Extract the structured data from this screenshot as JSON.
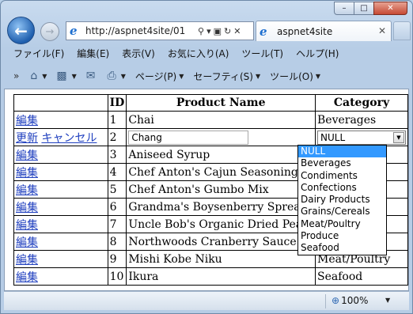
{
  "window": {
    "caption_buttons": {
      "minimize": "–",
      "maximize": "□",
      "close": "✕"
    }
  },
  "nav": {
    "address_url": "http://aspnet4site/01",
    "tab_title": "aspnet4site"
  },
  "menubar": [
    "ファイル(F)",
    "編集(E)",
    "表示(V)",
    "お気に入り(A)",
    "ツール(T)",
    "ヘルプ(H)"
  ],
  "commandbar": {
    "page": "ページ(P)",
    "safety": "セーフティ(S)",
    "tools": "ツール(O)"
  },
  "grid": {
    "headers": [
      "",
      "ID",
      "Product Name",
      "Category"
    ],
    "edit_row": {
      "update_label": "更新",
      "cancel_label": "キャンセル",
      "id": "2",
      "name_value": "Chang",
      "category_selected": "NULL"
    },
    "rows": [
      {
        "action": "編集",
        "id": "1",
        "name": "Chai",
        "category": "Beverages"
      },
      {
        "action": "編集",
        "id": "3",
        "name": "Aniseed Syrup",
        "category": ""
      },
      {
        "action": "編集",
        "id": "4",
        "name": "Chef Anton's Cajun Seasoning",
        "category": ""
      },
      {
        "action": "編集",
        "id": "5",
        "name": "Chef Anton's Gumbo Mix",
        "category": ""
      },
      {
        "action": "編集",
        "id": "6",
        "name": "Grandma's Boysenberry Spread",
        "category": ""
      },
      {
        "action": "編集",
        "id": "7",
        "name": "Uncle Bob's Organic Dried Pears",
        "category": ""
      },
      {
        "action": "編集",
        "id": "8",
        "name": "Northwoods Cranberry Sauce",
        "category": ""
      },
      {
        "action": "編集",
        "id": "9",
        "name": "Mishi Kobe Niku",
        "category": "Meat/Poultry"
      },
      {
        "action": "編集",
        "id": "10",
        "name": "Ikura",
        "category": "Seafood"
      }
    ],
    "dropdown_options": [
      "NULL",
      "Beverages",
      "Condiments",
      "Confections",
      "Dairy Products",
      "Grains/Cereals",
      "Meat/Poultry",
      "Produce",
      "Seafood"
    ]
  },
  "statusbar": {
    "zoom": "100%"
  }
}
